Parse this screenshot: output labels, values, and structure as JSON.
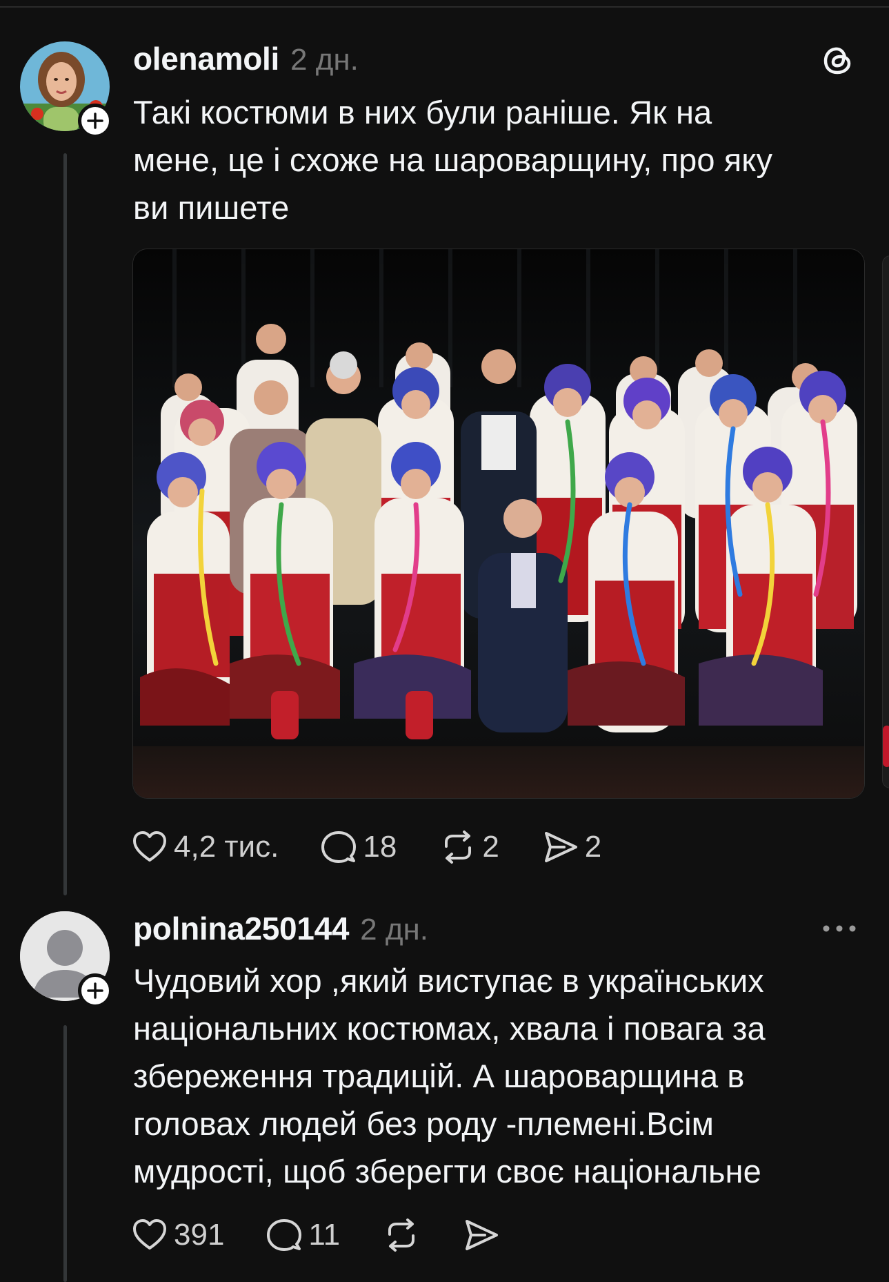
{
  "posts": [
    {
      "username": "olenamoli",
      "time": "2 дн.",
      "text": "Такі костюми в них були раніше. Як на\nмене, це і схоже на шароварщину, про яку\nви пишете",
      "photo_icon": "group-photo-ukrainian-costumes",
      "actions": {
        "likes": "4,2 тис.",
        "comments": "18",
        "reposts": "2",
        "shares": "2"
      }
    },
    {
      "username": "polnina250144",
      "time": "2 дн.",
      "text": "Чудовий хор ,який виступає в українських\nнаціональних костюмах, хвала і повага за\nзбереження традицій. А шароварщина в\nголовах людей без роду -племені.Всім\nмудрості, щоб зберегти своє національне",
      "actions": {
        "likes": "391",
        "comments": "11"
      }
    }
  ],
  "icons": {
    "brand": "threads-logo-icon",
    "like": "heart-icon",
    "comment": "comment-bubble-icon",
    "repost": "repost-icon",
    "share": "send-icon",
    "more": "more-dots-icon",
    "follow": "plus-icon"
  },
  "colors": {
    "background": "#101010",
    "text": "#f3f5f7",
    "muted": "#777777",
    "thread_line": "#333638"
  }
}
